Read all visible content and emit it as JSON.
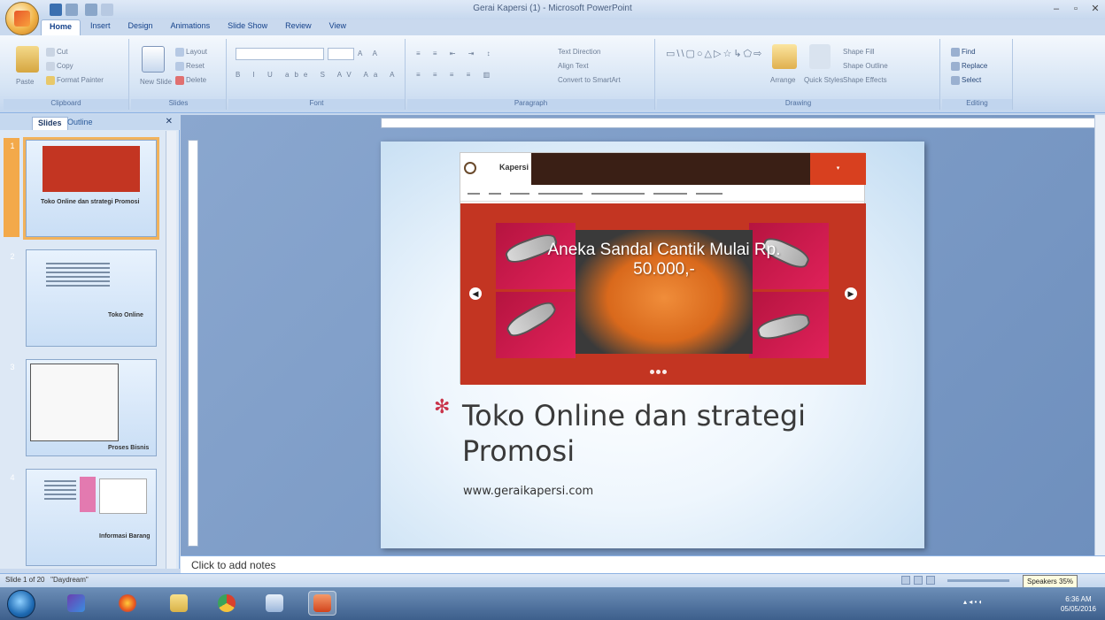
{
  "window": {
    "title": "Gerai Kapersi (1) - Microsoft PowerPoint"
  },
  "ribbon": {
    "tabs": [
      "Home",
      "Insert",
      "Design",
      "Animations",
      "Slide Show",
      "Review",
      "View"
    ],
    "groups": {
      "clipboard": {
        "label": "Clipboard",
        "paste": "Paste",
        "cut": "Cut",
        "copy": "Copy",
        "format_painter": "Format Painter"
      },
      "slides": {
        "label": "Slides",
        "new_slide": "New Slide",
        "layout": "Layout",
        "reset": "Reset",
        "delete": "Delete"
      },
      "font": {
        "label": "Font"
      },
      "paragraph": {
        "label": "Paragraph",
        "text_direction": "Text Direction",
        "align_text": "Align Text",
        "convert_smartart": "Convert to SmartArt"
      },
      "drawing": {
        "label": "Drawing",
        "arrange": "Arrange",
        "quick_styles": "Quick Styles",
        "shape_fill": "Shape Fill",
        "shape_outline": "Shape Outline",
        "shape_effects": "Shape Effects"
      },
      "editing": {
        "label": "Editing",
        "find": "Find",
        "replace": "Replace",
        "select": "Select"
      }
    }
  },
  "left_pane": {
    "tabs": [
      "Slides",
      "Outline"
    ],
    "thumbnails": [
      {
        "number": "1",
        "caption": "Toko Online dan strategi Promosi"
      },
      {
        "number": "2",
        "caption": "Toko Online"
      },
      {
        "number": "3",
        "caption": "Proses Bisnis"
      },
      {
        "number": "4",
        "caption": "Informasi Barang"
      }
    ]
  },
  "slide": {
    "banner_text": "Aneka Sandal Cantik Mulai Rp. 50.000,-",
    "website_logo": "Kapersi",
    "title": "Toko Online dan strategi Promosi",
    "subtitle": "www.geraikapersi.com"
  },
  "notes": {
    "placeholder": "Click to add notes"
  },
  "status": {
    "slide_info": "Slide 1 of 20",
    "theme": "\"Daydream\"",
    "zoom_tooltip": "Speakers 35%"
  },
  "taskbar": {
    "apps": [
      "media-player",
      "firefox",
      "file-explorer",
      "chrome",
      "taskbar-app",
      "powerpoint"
    ],
    "clock_time": "6:36 AM",
    "clock_date": "05/05/2016"
  },
  "colors": {
    "ribbon_bg": "#d4e3f4",
    "banner_red": "#c33522",
    "accent_orange": "#f2b25b",
    "title_dark": "#3a3a3a"
  }
}
